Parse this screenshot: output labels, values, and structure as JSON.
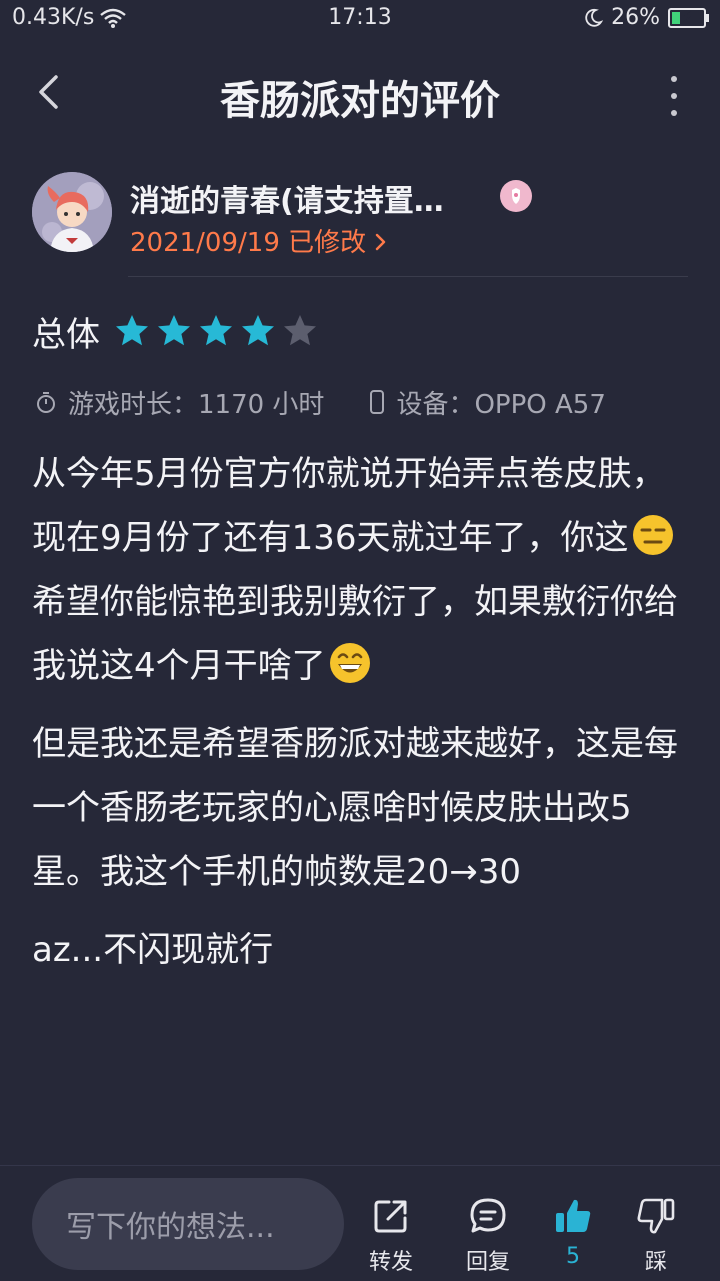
{
  "status_bar": {
    "speed": "0.43K/s",
    "time": "17:13",
    "battery_percent": "26%",
    "battery_level": 0.26,
    "icons": [
      "wifi-icon",
      "moon-icon",
      "battery-charging-icon"
    ]
  },
  "nav": {
    "title": "香肠派对的评价",
    "back_icon": "chevron-left-icon",
    "more_icon": "more-vertical-icon"
  },
  "user": {
    "name": "消逝的青春(请支持置…",
    "date": "2021/09/19 已修改",
    "date_color": "#ff7a4a"
  },
  "rating": {
    "label": "总体",
    "value": 4,
    "max": 5,
    "star_color": "#27b9d6",
    "empty_star_color": "#5c5e6e"
  },
  "meta": {
    "play_time": "游戏时长：1170 小时",
    "device": "设备：OPPO A57"
  },
  "review": {
    "p1_part1": "从今年5月份官方你就说开始弄点卷皮肤，现在9月份了还有136天就过年了，你这",
    "p1_part2": "希望你能惊艳到我别敷衍了，如果敷衍你给我说这4个月干啥了",
    "p2": "但是我还是希望香肠派对越来越好，这是每一个香肠老玩家的心愿啥时候皮肤出改5星。我这个手机的帧数是20→30",
    "p3": "az...不闪现就行"
  },
  "bottom_bar": {
    "input_placeholder": "写下你的想法...",
    "share_label": "转发",
    "reply_label": "回复",
    "like_count": "5",
    "dislike_label": "踩",
    "like_color": "#2ab3d4"
  }
}
